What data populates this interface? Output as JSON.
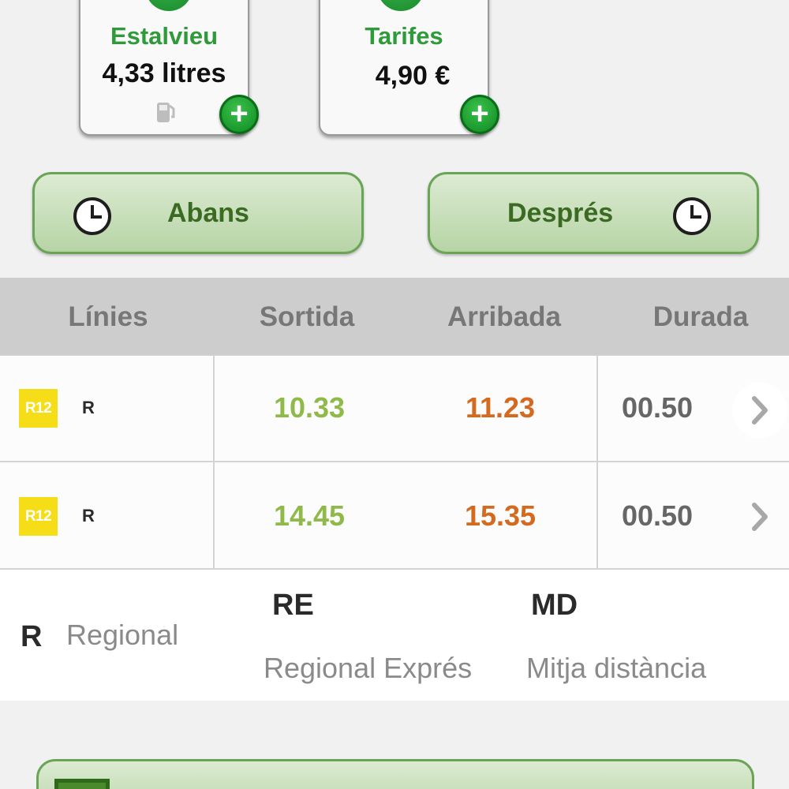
{
  "cards": {
    "savings": {
      "title": "Estalvieu",
      "value": "4,33 litres"
    },
    "fares": {
      "title": "Tarifes",
      "value": "4,90 €"
    }
  },
  "buttons": {
    "before_label": "Abans",
    "after_label": "Després"
  },
  "table": {
    "headers": {
      "lines": "Línies",
      "departure": "Sortida",
      "arrival": "Arribada",
      "duration": "Durada"
    },
    "rows": [
      {
        "line": "R12",
        "type": "R",
        "departure": "10.33",
        "arrival": "11.23",
        "duration": "00.50"
      },
      {
        "line": "R12",
        "type": "R",
        "departure": "14.45",
        "arrival": "15.35",
        "duration": "00.50"
      }
    ]
  },
  "legend": {
    "regional": {
      "code": "R",
      "name": "Regional"
    },
    "regional_express": {
      "code": "RE",
      "name": "Regional Exprés"
    },
    "mid_distance": {
      "code": "MD",
      "name": "Mitja distància"
    }
  },
  "colors": {
    "accent_green": "#2f9a39",
    "departure_time": "#8fba4a",
    "arrival_time": "#d36a1f",
    "line_badge": "#f5dd18"
  },
  "icons": {
    "card_add": "plus-icon",
    "clock": "clock-icon",
    "fuel": "fuel-pump-icon",
    "row_detail": "chevron-right-icon"
  }
}
